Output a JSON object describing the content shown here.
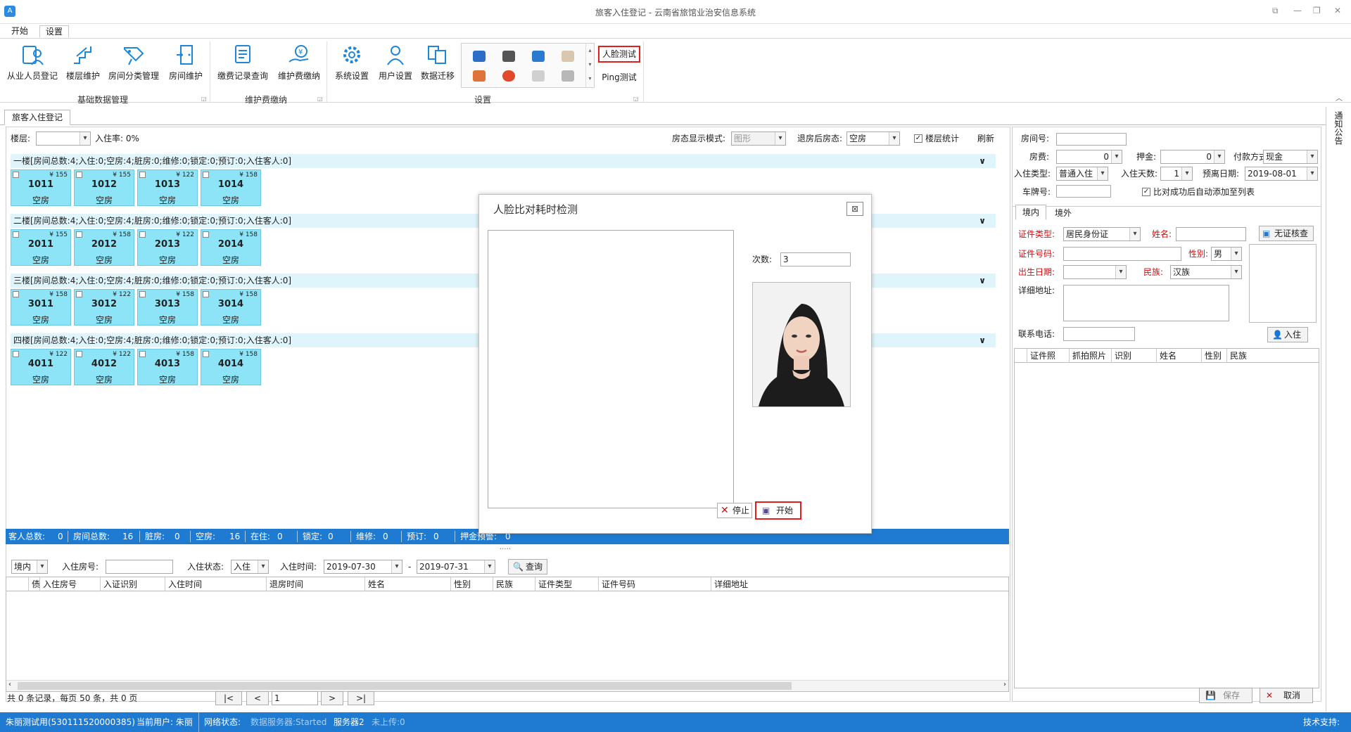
{
  "window": {
    "title": "旅客入住登记 - 云南省旅馆业治安信息系统",
    "app_icon": "A"
  },
  "menu": {
    "tabs": [
      "开始",
      "设置"
    ]
  },
  "ribbon": {
    "basic": {
      "label": "基础数据管理",
      "buttons": [
        "从业人员登记",
        "楼层维护",
        "房间分类管理",
        "房间维护"
      ]
    },
    "fee": {
      "label": "维护费缴纳",
      "buttons": [
        "缴费记录查询",
        "维护费缴纳"
      ]
    },
    "settings": {
      "label": "设置",
      "buttons": [
        "系统设置",
        "用户设置",
        "数据迁移"
      ]
    },
    "face_test": "人脸测试",
    "ping_test": "Ping测试"
  },
  "tab": {
    "label": "旅客入住登记"
  },
  "toolbar": {
    "floor_label": "楼层:",
    "occupancy_label": "入住率: 0%",
    "display_mode_label": "房态显示模式:",
    "display_mode_value": "图形",
    "after_checkout_label": "退房后房态:",
    "after_checkout_value": "空房",
    "floor_stats_label": "楼层统计",
    "refresh_label": "刷新"
  },
  "floors": [
    {
      "header": "一楼[房间总数:4;入住:0;空房:4;脏房:0;维修:0;锁定:0;预订:0;入住客人:0]",
      "rooms": [
        {
          "no": "1011",
          "price": "¥ 155",
          "status": "空房"
        },
        {
          "no": "1012",
          "price": "¥ 155",
          "status": "空房"
        },
        {
          "no": "1013",
          "price": "¥ 122",
          "status": "空房"
        },
        {
          "no": "1014",
          "price": "¥ 158",
          "status": "空房"
        }
      ]
    },
    {
      "header": "二楼[房间总数:4;入住:0;空房:4;脏房:0;维修:0;锁定:0;预订:0;入住客人:0]",
      "rooms": [
        {
          "no": "2011",
          "price": "¥ 155",
          "status": "空房"
        },
        {
          "no": "2012",
          "price": "¥ 158",
          "status": "空房"
        },
        {
          "no": "2013",
          "price": "¥ 122",
          "status": "空房"
        },
        {
          "no": "2014",
          "price": "¥ 158",
          "status": "空房"
        }
      ]
    },
    {
      "header": "三楼[房间总数:4;入住:0;空房:4;脏房:0;维修:0;锁定:0;预订:0;入住客人:0]",
      "rooms": [
        {
          "no": "3011",
          "price": "¥ 158",
          "status": "空房"
        },
        {
          "no": "3012",
          "price": "¥ 122",
          "status": "空房"
        },
        {
          "no": "3013",
          "price": "¥ 158",
          "status": "空房"
        },
        {
          "no": "3014",
          "price": "¥ 158",
          "status": "空房"
        }
      ]
    },
    {
      "header": "四楼[房间总数:4;入住:0;空房:4;脏房:0;维修:0;锁定:0;预订:0;入住客人:0]",
      "rooms": [
        {
          "no": "4011",
          "price": "¥ 122",
          "status": "空房"
        },
        {
          "no": "4012",
          "price": "¥ 122",
          "status": "空房"
        },
        {
          "no": "4013",
          "price": "¥ 158",
          "status": "空房"
        },
        {
          "no": "4014",
          "price": "¥ 158",
          "status": "空房"
        }
      ]
    }
  ],
  "stats": [
    {
      "label": "客人总数:",
      "value": "0"
    },
    {
      "label": "房间总数:",
      "value": "16"
    },
    {
      "label": "脏房:",
      "value": "0"
    },
    {
      "label": "空房:",
      "value": "16"
    },
    {
      "label": "在住:",
      "value": "0"
    },
    {
      "label": "锁定:",
      "value": "0"
    },
    {
      "label": "维修:",
      "value": "0"
    },
    {
      "label": "预订:",
      "value": "0"
    },
    {
      "label": "押金预警:",
      "value": "0"
    }
  ],
  "query": {
    "scope": "境内",
    "room_label": "入住房号:",
    "status_label": "入住状态:",
    "status_value": "入住",
    "time_label": "入住时间:",
    "date_from": "2019-07-30",
    "date_sep": "-",
    "date_to": "2019-07-31",
    "query_btn": "查询"
  },
  "table": {
    "columns": [
      "债",
      "入住房号",
      "入证识别",
      "入住时间",
      "退房时间",
      "姓名",
      "性别",
      "民族",
      "证件类型",
      "证件号码",
      "详细地址"
    ]
  },
  "pager": {
    "summary": "共 0 条记录，每页 50 条，共 0 页",
    "first": "|<",
    "prev": "<",
    "page": "1",
    "next": ">",
    "last": ">|"
  },
  "form": {
    "room_no": "房间号:",
    "room_fee": "房费:",
    "room_fee_value": "0",
    "deposit": "押金:",
    "deposit_value": "0",
    "pay_method": "付款方式:",
    "pay_method_value": "现金",
    "checkin_type": "入住类型:",
    "checkin_type_value": "普通入住",
    "days": "入住天数:",
    "days_value": "1",
    "leave_date": "预离日期:",
    "leave_date_value": "2019-08-01",
    "plate": "车牌号:",
    "auto_add": "比对成功后自动添加至列表",
    "tabs": [
      "境内",
      "境外"
    ],
    "id_type": "证件类型:",
    "id_type_value": "居民身份证",
    "name": "姓名:",
    "no_id_btn": "无证核查",
    "id_no": "证件号码:",
    "gender": "性别:",
    "gender_value": "男",
    "birth": "出生日期:",
    "ethnic": "民族:",
    "ethnic_value": "汉族",
    "address": "详细地址:",
    "phone": "联系电话:",
    "checkin_btn": "入住",
    "grid_cols": [
      "证件照",
      "抓拍照片",
      "识别",
      "姓名",
      "性别",
      "民族"
    ],
    "save": "保存",
    "cancel": "取消"
  },
  "sidebar": {
    "label": "通知公告"
  },
  "statusbar": {
    "user_id": "朱丽测试用(530111520000385)",
    "current_user": "当前用户: 朱丽",
    "network": "网络状态:",
    "server": "数据服务器:Started",
    "server2": "服务器2",
    "upload": "未上传:0",
    "support": "技术支持:"
  },
  "dialog": {
    "title": "人脸比对耗时检测",
    "count_label": "次数:",
    "count_value": "3",
    "stop": "停止",
    "start": "开始"
  },
  "colors": {
    "accent": "#1f7bd1",
    "room": "#8de4f7",
    "highlight": "#e02020"
  }
}
